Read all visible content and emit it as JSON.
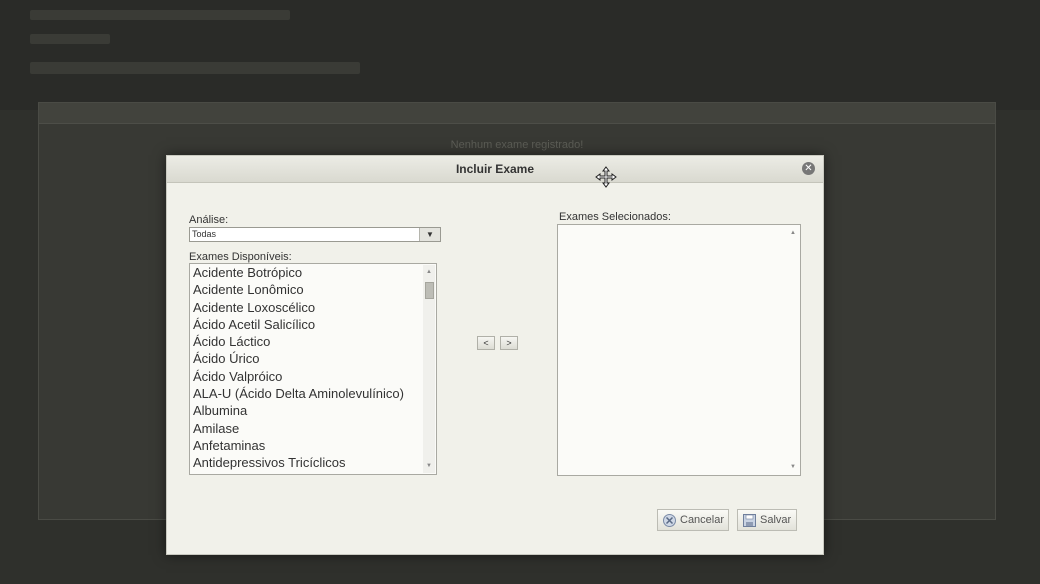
{
  "background": {
    "empty_message": "Nenhum exame registrado!"
  },
  "dialog": {
    "title": "Incluir Exame",
    "analise": {
      "label": "Análise:",
      "selected": "Todas"
    },
    "available": {
      "label": "Exames Disponíveis:",
      "items": [
        "Acidente Botrópico",
        "Acidente Lonômico",
        "Acidente Loxoscélico",
        "Ácido Acetil Salicílico",
        "Ácido Láctico",
        "Ácido Úrico",
        "Ácido Valpróico",
        "ALA-U (Ácido Delta Aminolevulínico)",
        "Albumina",
        "Amilase",
        "Anfetaminas",
        "Antidepressivos Tricíclicos"
      ]
    },
    "selected": {
      "label": "Exames Selecionados:",
      "items": []
    },
    "move_left": "<",
    "move_right": ">",
    "cancel_label": "Cancelar",
    "save_label": "Salvar"
  }
}
